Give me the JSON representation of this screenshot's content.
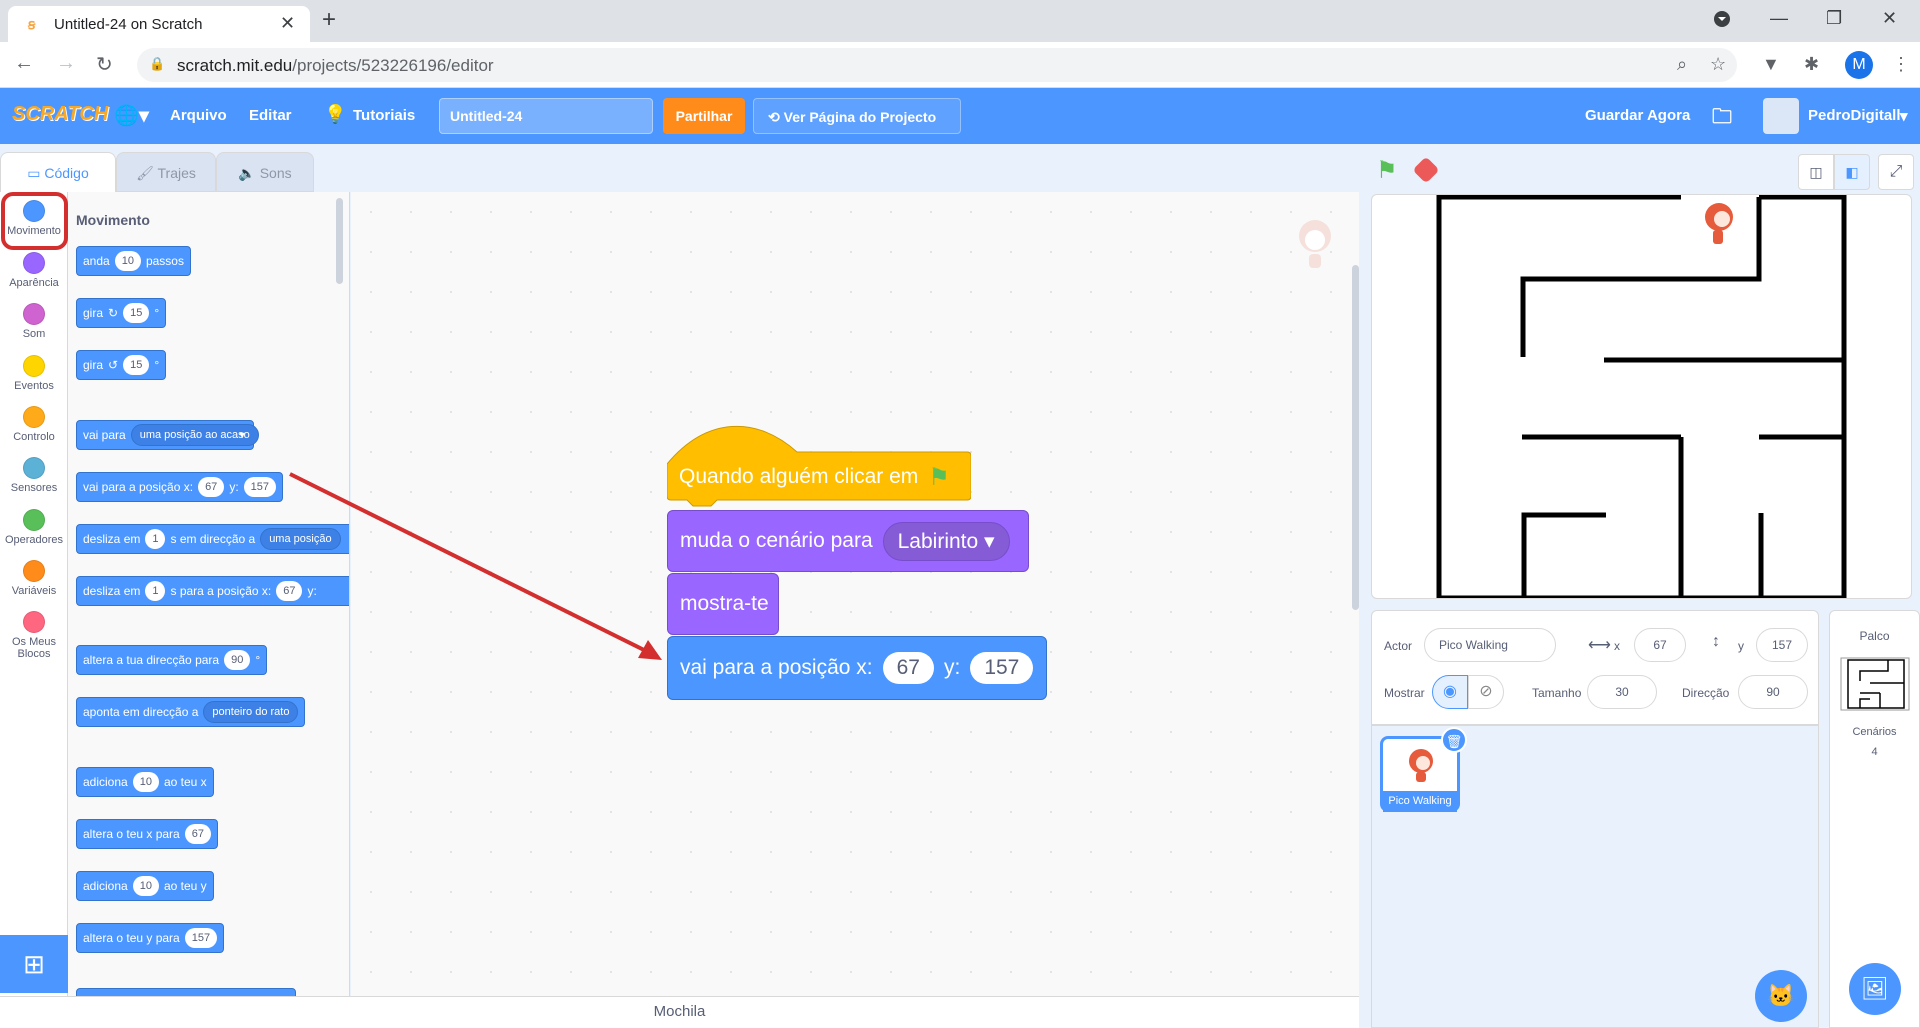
{
  "browser": {
    "tab_title": "Untitled-24 on Scratch",
    "url_domain": "scratch.mit.edu",
    "url_path": "/projects/523226196/editor",
    "profile_initial": "M"
  },
  "menu": {
    "logo": "SCRATCH",
    "file": "Arquivo",
    "edit": "Editar",
    "tutorials": "Tutoriais",
    "project_name": "Untitled-24",
    "share": "Partilhar",
    "see_project": "Ver Página do Projecto",
    "save_now": "Guardar Agora",
    "username": "PedroDigitall"
  },
  "editor_tabs": {
    "code": "Código",
    "costumes": "Trajes",
    "sounds": "Sons"
  },
  "categories": [
    {
      "label": "Movimento",
      "color": "#4c97ff"
    },
    {
      "label": "Aparência",
      "color": "#9966ff"
    },
    {
      "label": "Som",
      "color": "#cf63cf"
    },
    {
      "label": "Eventos",
      "color": "#ffd500"
    },
    {
      "label": "Controlo",
      "color": "#ffab19"
    },
    {
      "label": "Sensores",
      "color": "#5cb1d6"
    },
    {
      "label": "Operadores",
      "color": "#59c059"
    },
    {
      "label": "Variáveis",
      "color": "#ff8c1a"
    },
    {
      "label": "Os Meus Blocos",
      "color": "#ff6680"
    }
  ],
  "palette": {
    "heading": "Movimento",
    "move": {
      "a": "anda",
      "v": "10",
      "b": "passos"
    },
    "turn_right": {
      "a": "gira",
      "v": "15",
      "b": "°"
    },
    "turn_left": {
      "a": "gira",
      "v": "15",
      "b": "°"
    },
    "goto": {
      "a": "vai para",
      "d": "uma posição ao acaso"
    },
    "gotoxy": {
      "a": "vai para a posição x:",
      "x": "67",
      "b": "y:",
      "y": "157"
    },
    "glide1": {
      "a": "desliza em",
      "v": "1",
      "b": "s em direcção a",
      "d": "uma posição"
    },
    "glide2": {
      "a": "desliza em",
      "v": "1",
      "b": "s para a posição x:",
      "x": "67",
      "c": "y:"
    },
    "point_dir": {
      "a": "altera a tua direcção para",
      "v": "90",
      "b": "°"
    },
    "point_towards": {
      "a": "aponta em direcção a",
      "d": "ponteiro do rato"
    },
    "change_x": {
      "a": "adiciona",
      "v": "10",
      "b": "ao teu x"
    },
    "set_x": {
      "a": "altera o teu x para",
      "v": "67"
    },
    "change_y": {
      "a": "adiciona",
      "v": "10",
      "b": "ao teu y"
    },
    "set_y": {
      "a": "altera o teu y para",
      "v": "157"
    }
  },
  "script": {
    "hat": "Quando alguém clicar em",
    "switch_backdrop": "muda o cenário para",
    "backdrop_value": "Labirinto",
    "show": "mostra-te",
    "goto_label": "vai para a posição x:",
    "x": "67",
    "y_label": "y:",
    "y": "157"
  },
  "backpack": "Mochila",
  "sprite_info": {
    "sprite_label": "Actor",
    "sprite_name": "Pico Walking",
    "x_label": "x",
    "x": "67",
    "y_label": "y",
    "y": "157",
    "show_label": "Mostrar",
    "size_label": "Tamanho",
    "size": "30",
    "direction_label": "Direcção",
    "direction": "90"
  },
  "sprite_tile": {
    "name": "Pico Walking"
  },
  "stage_panel": {
    "title": "Palco",
    "backdrops_label": "Cenários",
    "backdrops_count": "4"
  },
  "colors": {
    "motion": "#4c97ff",
    "looks": "#9966ff",
    "events": "#ffbf00",
    "annotation": "#d32f2f"
  }
}
